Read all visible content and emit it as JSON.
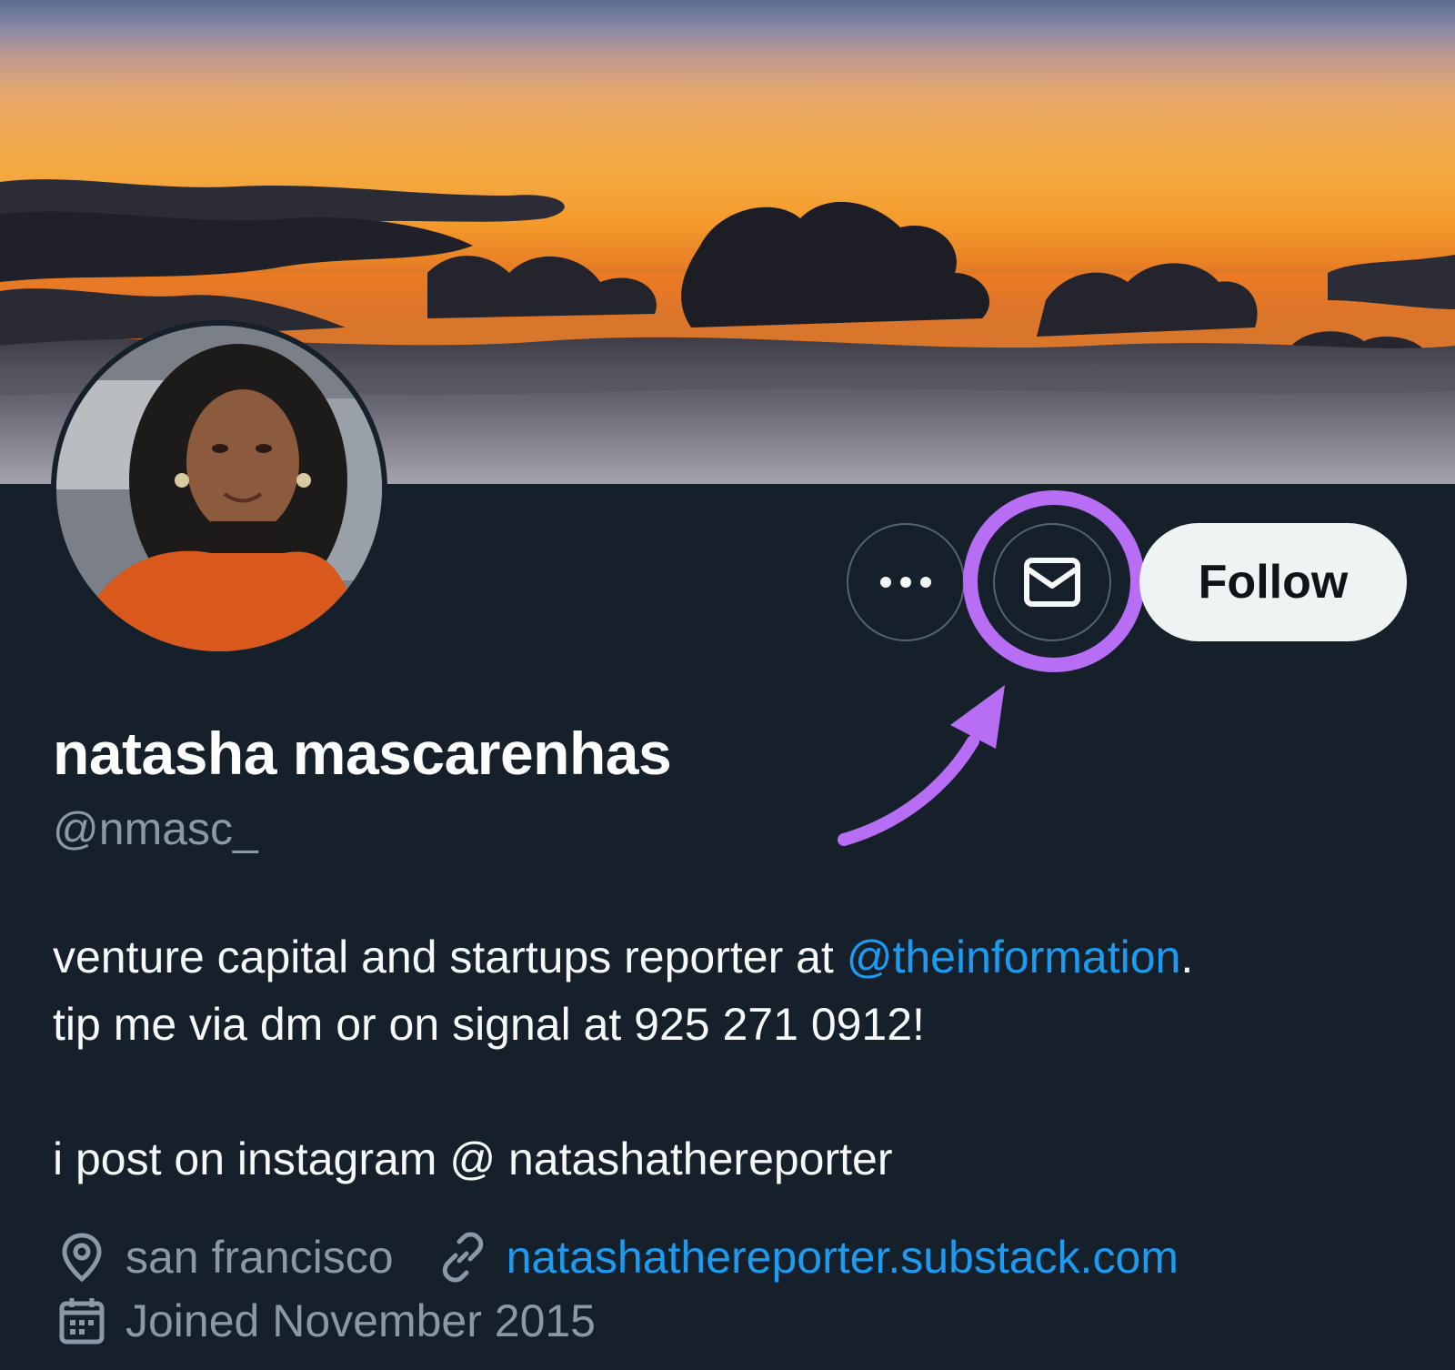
{
  "profile": {
    "name": "natasha mascarenhas",
    "handle": "@nmasc_",
    "bio": {
      "line1_prefix": "venture capital and startups reporter at ",
      "line1_mention": "@theinformation",
      "line1_suffix": ".",
      "line2": "tip me via dm or on signal at 925 271 0912!",
      "line3": "i post on instagram @ natashathereporter"
    },
    "location": "san francisco",
    "website": "natashathereporter.substack.com",
    "joined": "Joined November 2015"
  },
  "actions": {
    "more_icon": "more-horizontal-icon",
    "message_icon": "envelope-icon",
    "follow_label": "Follow"
  },
  "icons": {
    "location": "location-pin-icon",
    "website": "link-icon",
    "joined": "calendar-icon"
  },
  "colors": {
    "background": "#15202b",
    "accent_link": "#1d9bf0",
    "highlight": "#b76ef5",
    "muted_text": "#8b98a5",
    "follow_button": "#eff3f4"
  }
}
